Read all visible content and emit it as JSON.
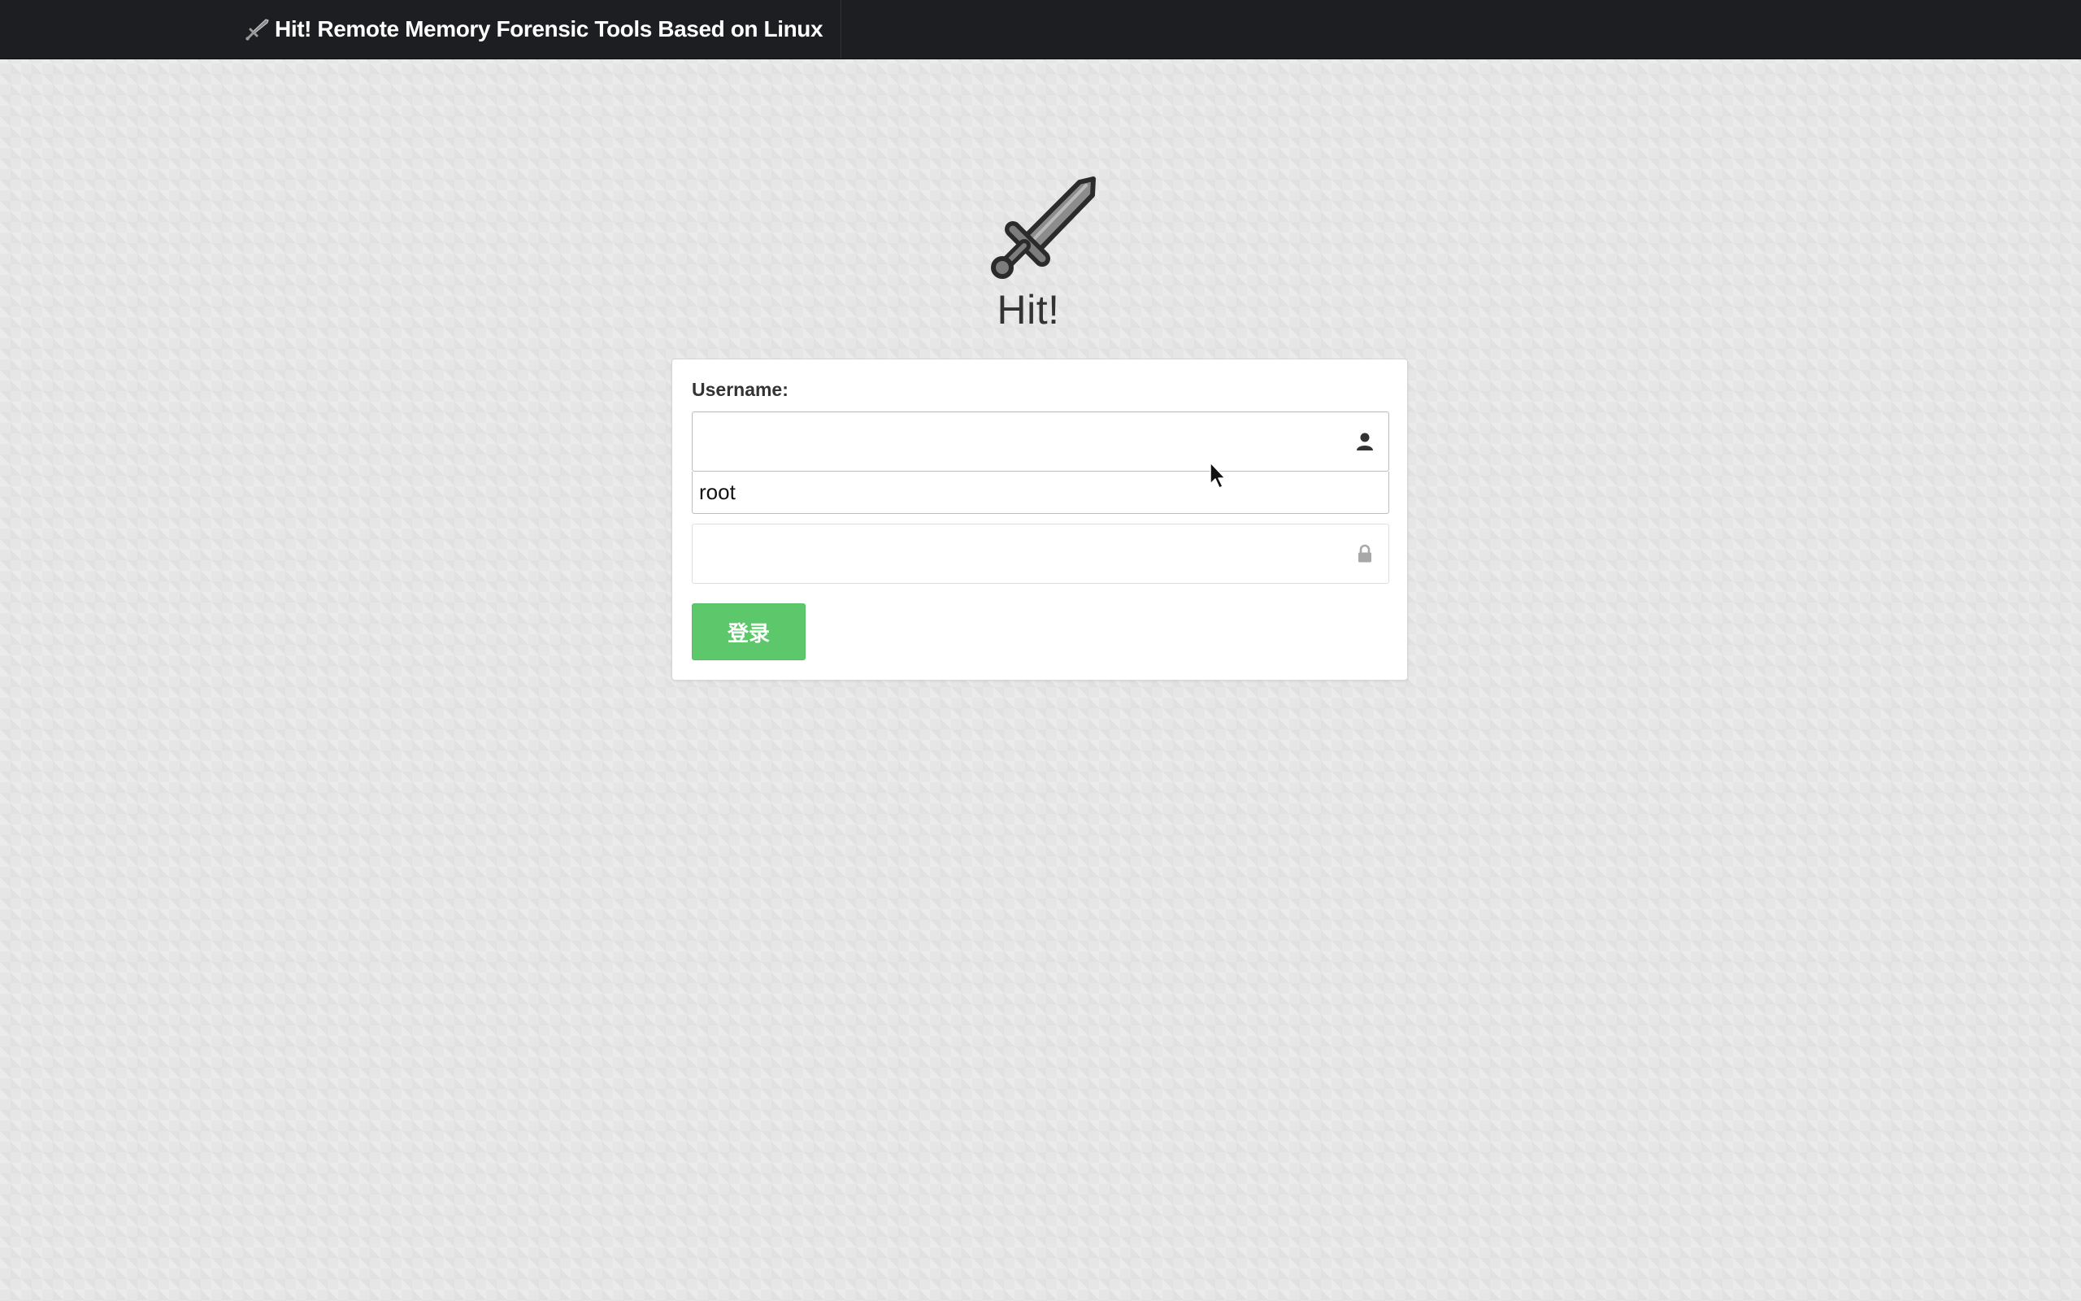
{
  "navbar": {
    "brand_title": "Hit! Remote Memory Forensic Tools Based on Linux",
    "brand_icon": "sword-icon"
  },
  "logo": {
    "icon": "sword-icon",
    "title": "Hit!"
  },
  "login_form": {
    "username_label": "Username:",
    "username_value": "",
    "username_icon": "user-icon",
    "autocomplete_suggestion": "root",
    "password_value": "",
    "password_icon": "lock-icon",
    "login_button_label": "登录"
  },
  "colors": {
    "navbar_bg": "#1d1e21",
    "login_button": "#5cc86b",
    "page_bg": "#e6e6e6"
  }
}
